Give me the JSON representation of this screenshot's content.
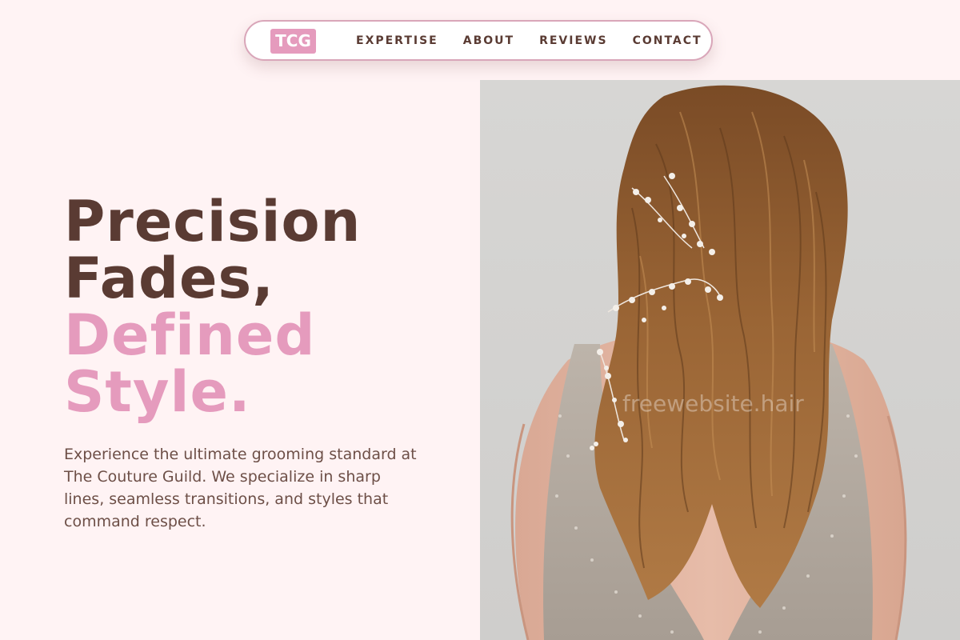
{
  "nav": {
    "logo": "TCG",
    "links": [
      "EXPERTISE",
      "ABOUT",
      "REVIEWS",
      "CONTACT"
    ]
  },
  "hero": {
    "title_line_1": "Precision",
    "title_line_2": "Fades,",
    "title_line_3": "Defined",
    "title_line_4": "Style.",
    "description": "Experience the ultimate grooming standard at The Couture Guild. We specialize in sharp lines, seamless transitions, and styles that command respect."
  },
  "image": {
    "watermark": "freewebsite.hair"
  },
  "colors": {
    "background": "#fff3f4",
    "brand_dark": "#5a3b33",
    "brand_pink": "#e59bbd",
    "nav_border": "#d9a6b9"
  }
}
